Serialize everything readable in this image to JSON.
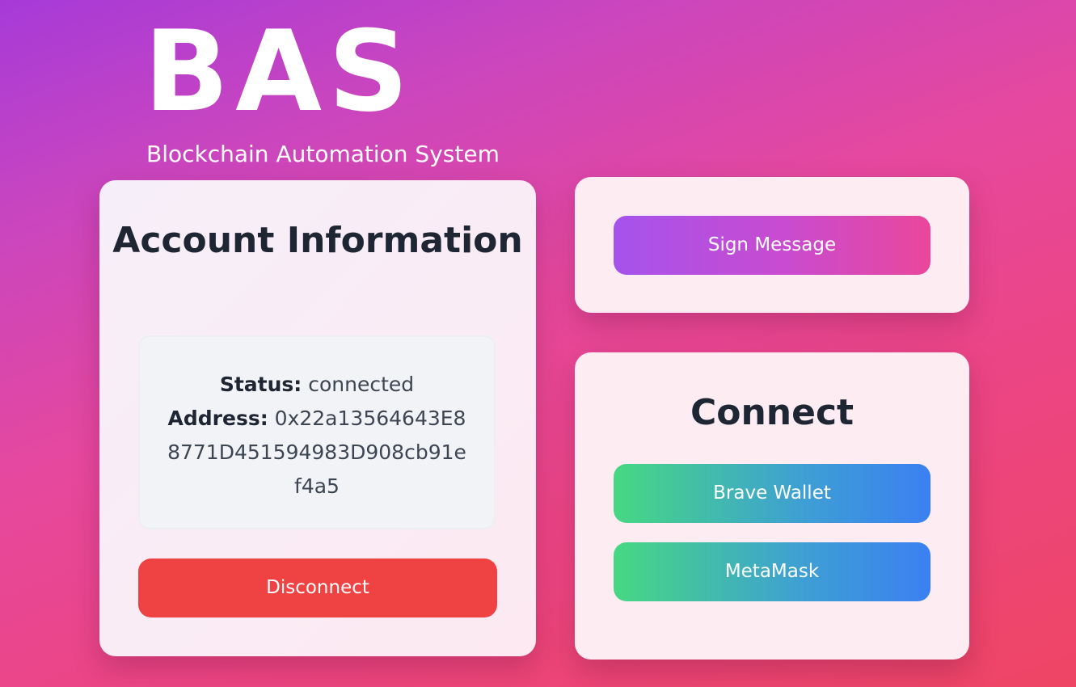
{
  "brand": {
    "title": "BAS",
    "subtitle": "Blockchain Automation System"
  },
  "account": {
    "heading": "Account Information",
    "status_label": "Status:",
    "status_value": "connected",
    "address_label": "Address:",
    "address_value": "0x22a13564643E88771D451594983D908cb91ef4a5",
    "disconnect_label": "Disconnect"
  },
  "sign": {
    "button_label": "Sign Message"
  },
  "connect": {
    "heading": "Connect",
    "wallets": [
      {
        "label": "Brave Wallet"
      },
      {
        "label": "MetaMask"
      }
    ]
  },
  "colors": {
    "background_start": "#a63ad8",
    "background_end": "#ee4564",
    "card": "#fdedf2",
    "heading_text": "#1f2633",
    "disconnect": "#ef4242",
    "sign_gradient_start": "#a553ec",
    "sign_gradient_end": "#ea479b",
    "wallet_gradient_start": "#46d882",
    "wallet_gradient_end": "#3b80f2"
  }
}
